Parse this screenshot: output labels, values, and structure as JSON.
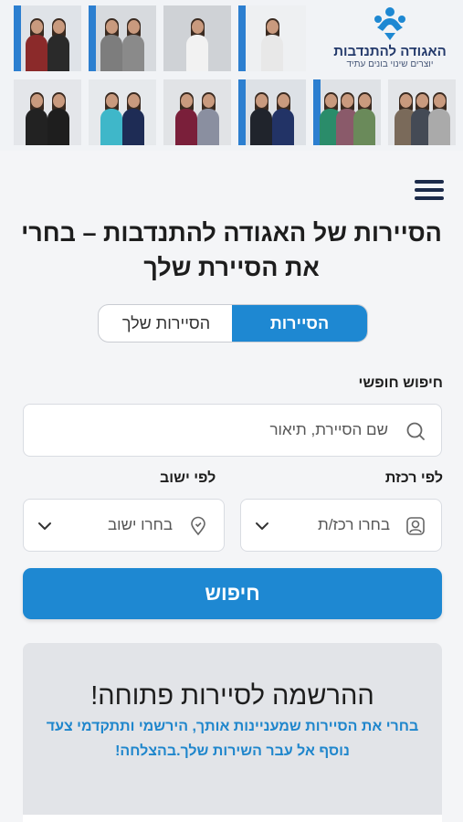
{
  "header": {
    "logo_title": "האגודה להתנדבות",
    "logo_subtitle": "יוצרים שינוי בונים עתיד",
    "photos": [
      {
        "wall": "#dfe3e8",
        "accent": "#2c7fd0",
        "people": [
          "#8b2a2a",
          "#2a2a2a"
        ]
      },
      {
        "wall": "#d7dade",
        "accent": "#2c7fd0",
        "people": [
          "#7d7d7d",
          "#8a8a8a"
        ]
      },
      {
        "wall": "#cfd2d6",
        "accent": "#cfd2d6",
        "people": [
          "#f2f2f2"
        ]
      },
      {
        "wall": "#eef0f2",
        "accent": "#2c7fd0",
        "people": [
          "#e8e8e8"
        ]
      },
      {
        "wall": "#e4e6ea",
        "accent": "#e4e6ea",
        "people": [
          "#222222",
          "#1e1e1e"
        ]
      },
      {
        "wall": "#e6e9ec",
        "accent": "#e6e9ec",
        "people": [
          "#3fb7c9",
          "#1e2c55"
        ]
      },
      {
        "wall": "#e1e3e6",
        "accent": "#e1e3e6",
        "people": [
          "#7a1f3a",
          "#8a8fa0"
        ]
      },
      {
        "wall": "#dde1e6",
        "accent": "#2c7fd0",
        "people": [
          "#20242c",
          "#223366"
        ]
      },
      {
        "wall": "#dfe2e6",
        "accent": "#2c7fd0",
        "people": [
          "#2a8c6a",
          "#8a5a6a",
          "#6a8a5a"
        ]
      },
      {
        "wall": "#e3e5e8",
        "accent": "#e3e5e8",
        "people": [
          "#7a6a5a",
          "#444a55",
          "#aaaaaa"
        ]
      }
    ]
  },
  "title": "הסיירות של האגודה להתנדבות – בחרי את הסיירת שלך",
  "tabs": {
    "active": "הסיירות",
    "inactive": "הסיירות שלך"
  },
  "free_search": {
    "label": "חיפוש חופשי",
    "placeholder": "שם הסיירת, תיאור"
  },
  "by_coordinator": {
    "label": "לפי רכזת",
    "placeholder": "בחרו רכז/ת"
  },
  "by_settlement": {
    "label": "לפי ישוב",
    "placeholder": "בחרו ישוב"
  },
  "search_button": "חיפוש",
  "registration": {
    "title": "ההרשמה לסיירות פתוחה!",
    "text": "בחרי את הסיירות שמעניינות אותך, הירשמי ותתקדמי צעד נוסף אל עבר השירות שלך.בהצלחה!"
  },
  "colors": {
    "primary": "#1e88d2",
    "logo": "#1e88d2",
    "link_text": "#1f86cc"
  },
  "icons": {
    "menu": "hamburger-icon",
    "search": "search-icon",
    "coordinator": "user-icon",
    "settlement": "location-pin-icon",
    "dropdown": "chevron-down-icon"
  }
}
